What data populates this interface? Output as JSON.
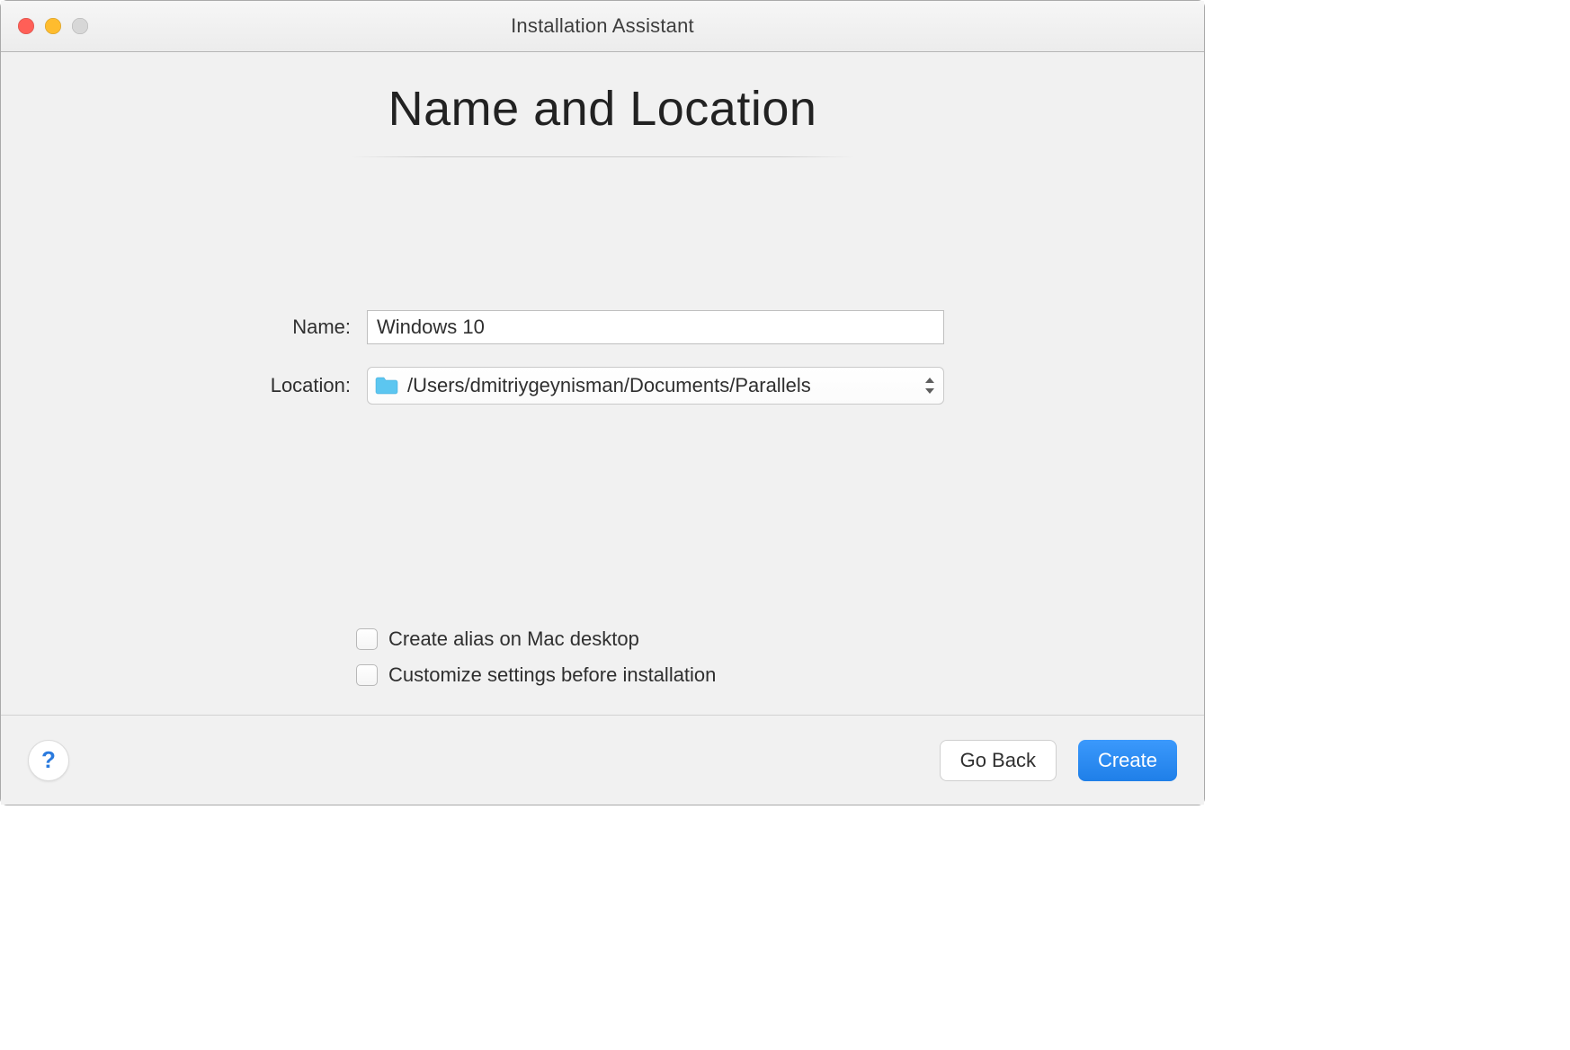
{
  "window": {
    "title": "Installation Assistant"
  },
  "heading": "Name and Location",
  "form": {
    "name_label": "Name:",
    "name_value": "Windows 10",
    "location_label": "Location:",
    "location_value": "/Users/dmitriygeynisman/Documents/Parallels"
  },
  "options": {
    "alias_label": "Create alias on Mac desktop",
    "customize_label": "Customize settings before installation"
  },
  "footer": {
    "help_symbol": "?",
    "go_back_label": "Go Back",
    "create_label": "Create"
  }
}
